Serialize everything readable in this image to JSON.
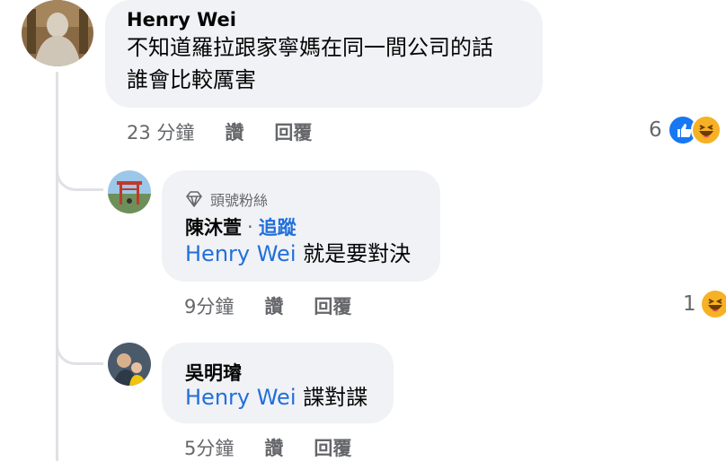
{
  "comments": [
    {
      "author": "Henry Wei",
      "lines": [
        "不知道羅拉跟家寧媽在同一間公司的話",
        "誰會比較厲害"
      ],
      "time": "23 分鐘",
      "like_label": "讚",
      "reply_label": "回覆",
      "reaction_count": "6",
      "reactions": [
        "like-icon",
        "haha-icon"
      ]
    }
  ],
  "replies": [
    {
      "badge": "頭號粉絲",
      "author": "陳沐萱",
      "separator": "·",
      "follow_label": "追蹤",
      "mention": "Henry Wei",
      "text": "就是要對決",
      "time": "9分鐘",
      "like_label": "讚",
      "reply_label": "回覆",
      "reaction_count": "1",
      "reactions": [
        "haha-icon"
      ]
    },
    {
      "author": "吳明璿",
      "mention": "Henry Wei",
      "text": "諜對諜",
      "time": "5分鐘",
      "like_label": "讚",
      "reply_label": "回覆"
    }
  ],
  "colors": {
    "bubble": "#f0f2f5",
    "mention": "#216fdb",
    "secondary_text": "#65676b",
    "like": "#1877f2",
    "haha": "#f7b125"
  }
}
